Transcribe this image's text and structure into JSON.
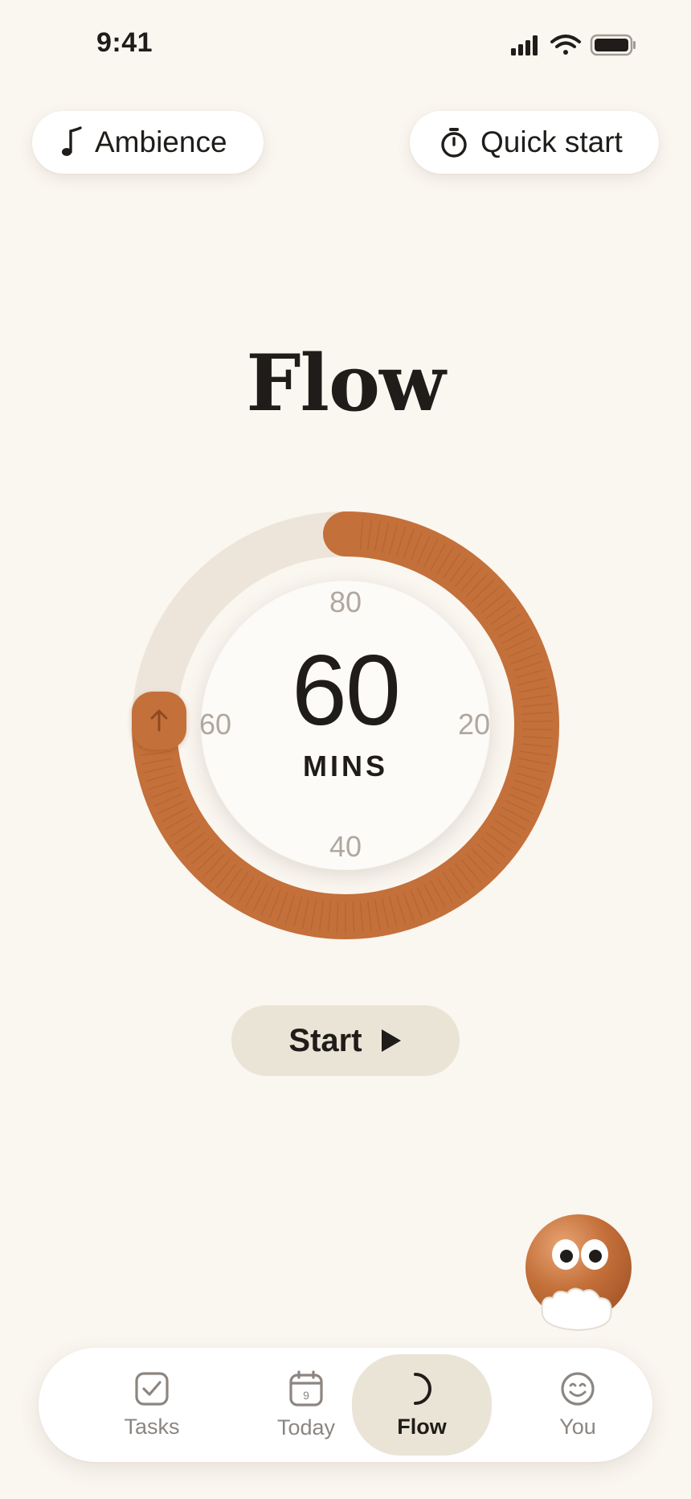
{
  "status_bar": {
    "time": "9:41",
    "icons": [
      "cellular-icon",
      "wifi-icon",
      "battery-icon"
    ]
  },
  "top_actions": {
    "ambience": {
      "label": "Ambience",
      "icon": "music-note-icon"
    },
    "quick_start": {
      "label": "Quick start",
      "icon": "stopwatch-icon"
    }
  },
  "title": "Flow",
  "dial": {
    "value": "60",
    "unit": "MINS",
    "tick_labels": {
      "top": "80",
      "right": "20",
      "bottom": "40",
      "left": "60"
    },
    "selected_minutes": 60,
    "max_minutes": 80,
    "accent_color": "#C4703A",
    "track_color": "#EDE5DA"
  },
  "start_button": {
    "label": "Start",
    "icon": "play-icon"
  },
  "tab_bar": {
    "tabs": [
      {
        "label": "Tasks",
        "icon": "checkbox-icon",
        "active": false
      },
      {
        "label": "Today",
        "icon": "calendar-icon",
        "calendar_day": "9",
        "active": false
      },
      {
        "label": "Flow",
        "icon": "flow-arc-icon",
        "active": true
      },
      {
        "label": "You",
        "icon": "smiley-icon",
        "active": false
      }
    ]
  },
  "colors": {
    "background": "#FAF6F0",
    "accent": "#C4703A",
    "button_bg": "#EAE4D7",
    "text": "#1F1C19"
  }
}
